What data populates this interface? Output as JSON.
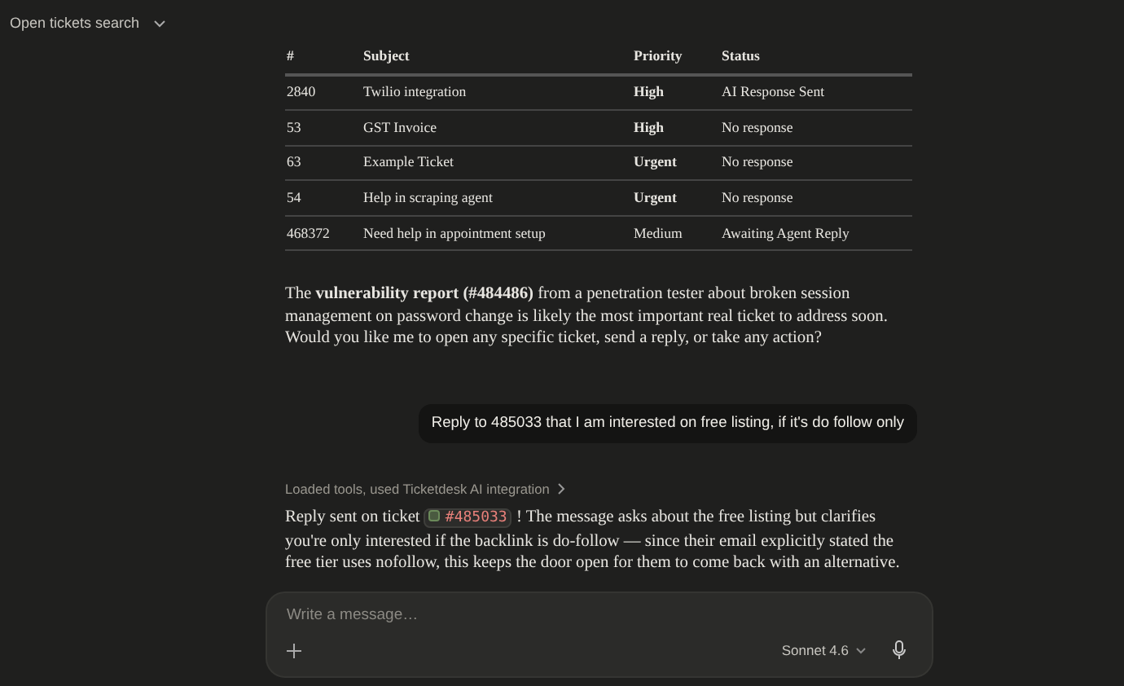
{
  "header": {
    "title": "Open tickets search"
  },
  "table": {
    "columns": [
      "#",
      "Subject",
      "Priority",
      "Status"
    ],
    "rows": [
      {
        "id": "2840",
        "subject": "Twilio integration",
        "priority": "High",
        "priority_bold": true,
        "status": "AI Response Sent"
      },
      {
        "id": "53",
        "subject": "GST Invoice",
        "priority": "High",
        "priority_bold": true,
        "status": "No response"
      },
      {
        "id": "63",
        "subject": "Example Ticket",
        "priority": "Urgent",
        "priority_bold": true,
        "status": "No response"
      },
      {
        "id": "54",
        "subject": "Help in scraping agent",
        "priority": "Urgent",
        "priority_bold": true,
        "status": "No response"
      },
      {
        "id": "468372",
        "subject": "Need help in appointment setup",
        "priority": "Medium",
        "priority_bold": false,
        "status": "Awaiting Agent Reply"
      }
    ]
  },
  "assistant_summary": "The **vulnerability report (#484486)** from a penetration tester about broken session management on password change is likely the most important real ticket to address soon. Would you like me to open any specific ticket, send a reply, or take any action?",
  "user_message": "Reply to 485033 that I am interested on free listing, if it's do follow only",
  "tool_status": "Loaded tools, used Ticketdesk AI integration",
  "reply": {
    "before": "Reply sent on ticket",
    "ticket": "#485033",
    "after": "! The message asks about the free listing but clarifies you're only interested if the backlink is do-follow — since their email explicitly stated the free tier uses nofollow, this keeps the door open for them to come back with an alternative."
  },
  "composer": {
    "placeholder": "Write a message…",
    "model": "Sonnet 4.6"
  }
}
